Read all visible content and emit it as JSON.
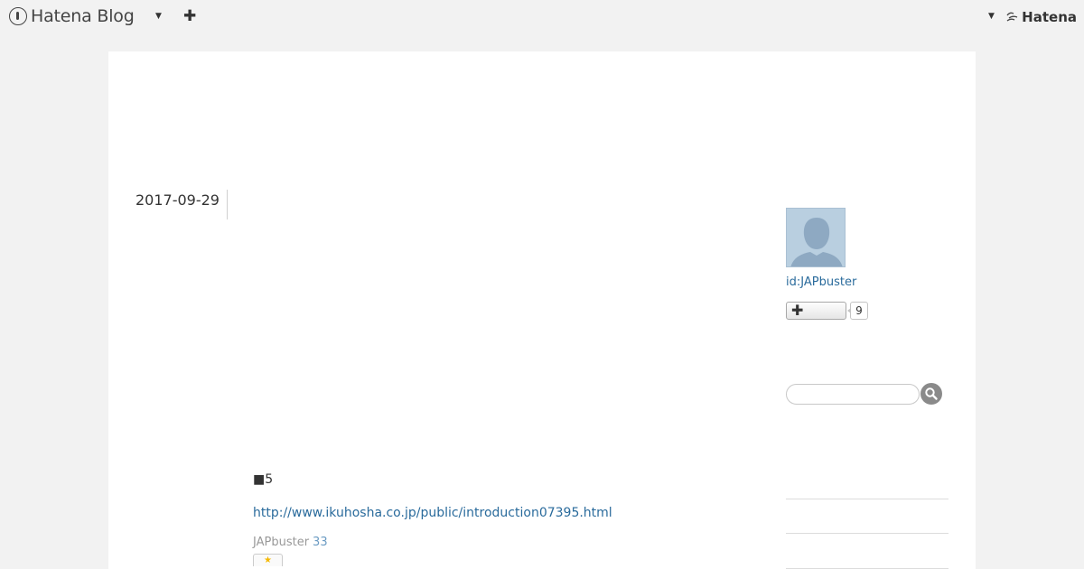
{
  "globalbar": {
    "brand_label": "Hatena Blog",
    "hatena_label": "Hatena",
    "icons": [
      "hatena-blog-logo-icon",
      "caret-down-icon",
      "plus-icon",
      "hatena-mark-icon"
    ]
  },
  "entry": {
    "date": "2017-09-29",
    "heading": "■5",
    "link_text": "http://www.ikuhosha.co.jp/public/introduction07395.html",
    "author": "JAPbuster",
    "star_count": "33"
  },
  "sidebar": {
    "profile_id": "id:JAPbuster",
    "follow_count": "9",
    "search_placeholder": ""
  },
  "colors": {
    "page_background": "#f2f2f2",
    "content_background": "#ffffff",
    "link": "#2a6b9c",
    "muted_text": "#999999",
    "avatar_fill": "#b9cfe0"
  }
}
